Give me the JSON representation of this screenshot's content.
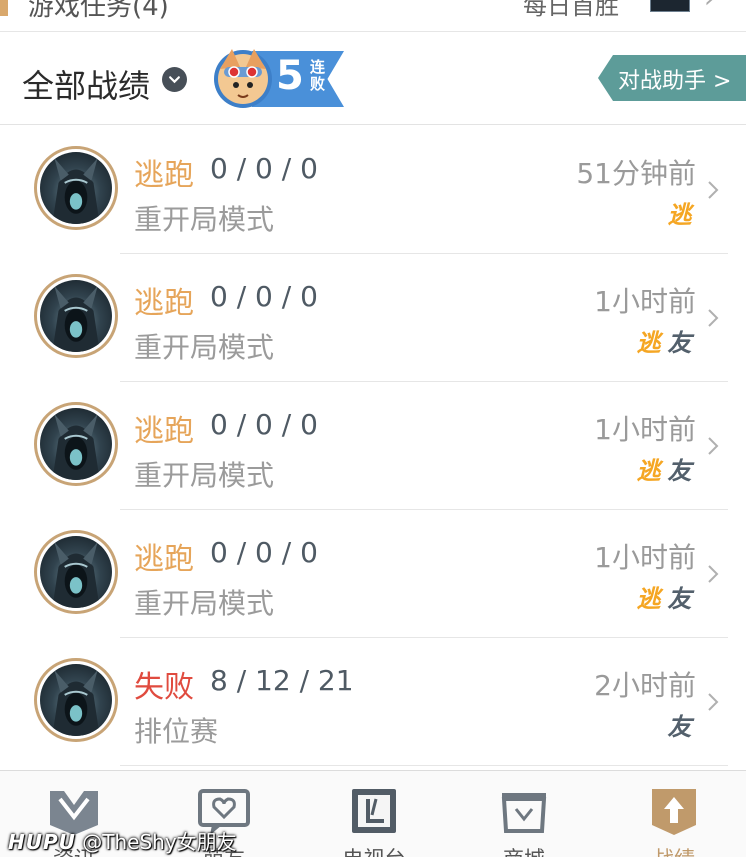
{
  "top_bar": {
    "quest_title": "游戏任务(4)",
    "daily_label": "每日首胜"
  },
  "header": {
    "all_records_label": "全部战绩",
    "streak": {
      "number": "5",
      "word": "连败",
      "color": "#4a90d9"
    },
    "assistant_label": "对战助手 >"
  },
  "colors": {
    "flee": "#e6a55a",
    "loss": "#e04b3f",
    "accent_gold": "#c8a476",
    "assistant": "#5d9c99"
  },
  "records": [
    {
      "result": "逃跑",
      "result_type": "flee",
      "kda": "0 / 0 / 0",
      "mode": "重开局模式",
      "time": "51分钟前",
      "tags": [
        "flee"
      ]
    },
    {
      "result": "逃跑",
      "result_type": "flee",
      "kda": "0 / 0 / 0",
      "mode": "重开局模式",
      "time": "1小时前",
      "tags": [
        "flee",
        "friend"
      ]
    },
    {
      "result": "逃跑",
      "result_type": "flee",
      "kda": "0 / 0 / 0",
      "mode": "重开局模式",
      "time": "1小时前",
      "tags": [
        "flee",
        "friend"
      ]
    },
    {
      "result": "逃跑",
      "result_type": "flee",
      "kda": "0 / 0 / 0",
      "mode": "重开局模式",
      "time": "1小时前",
      "tags": [
        "flee",
        "friend"
      ]
    },
    {
      "result": "失败",
      "result_type": "loss",
      "kda": "8 / 12 / 21",
      "mode": "排位赛",
      "time": "2小时前",
      "tags": [
        "friend"
      ]
    }
  ],
  "tag_labels": {
    "flee": "逃",
    "friend": "友"
  },
  "bottom_nav": [
    {
      "label": "资讯",
      "icon": "news-icon"
    },
    {
      "label": "萌友",
      "icon": "friends-icon"
    },
    {
      "label": "电视台",
      "icon": "tv-icon"
    },
    {
      "label": "商城",
      "icon": "shop-icon"
    },
    {
      "label": "战绩",
      "icon": "records-icon",
      "active": true
    }
  ],
  "watermark": {
    "brand": "HUPU",
    "handle": "@TheShy女朋友"
  }
}
